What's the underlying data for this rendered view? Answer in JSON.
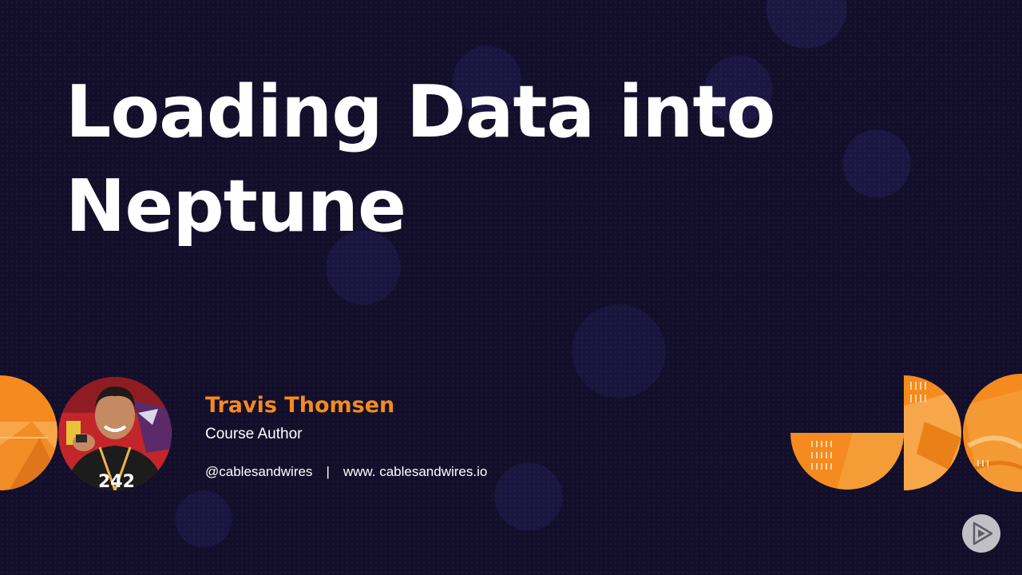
{
  "slide": {
    "title_line1": "Loading Data into",
    "title_line2": "Neptune"
  },
  "author": {
    "name": "Travis Thomsen",
    "role": "Course Author",
    "handle": "@cablesandwires",
    "separator": "|",
    "website": "www. cablesandwires.io",
    "avatar_icon": "author-photo"
  },
  "player": {
    "icon": "play-icon"
  },
  "colors": {
    "background": "#130f2b",
    "accent_orange": "#f58a1f",
    "text": "#ffffff"
  }
}
